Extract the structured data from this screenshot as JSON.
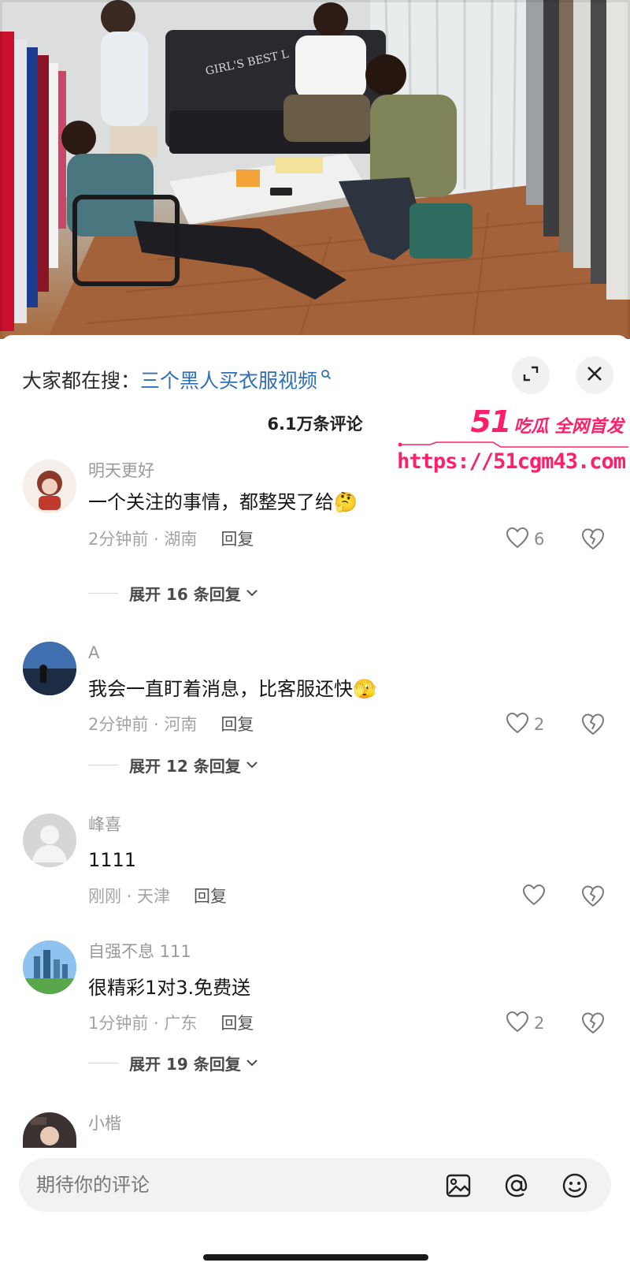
{
  "header": {
    "search_prefix": "大家都在搜：",
    "search_term": "三个黑人买衣服视频",
    "comment_count": "6.1万条评论"
  },
  "watermark": {
    "badge_number": "51",
    "badge_text": "吃瓜 全网首发",
    "url": "https://51cgm43.com"
  },
  "comments": [
    {
      "name": "明天更好",
      "text": "一个关注的事情，都整哭了给🤔",
      "time_location": "2分钟前 · 湖南",
      "reply_label": "回复",
      "likes": "6",
      "expand": "展开 16 条回复"
    },
    {
      "name": "A",
      "text": "我会一直盯着消息，比客服还快🫣",
      "time_location": "2分钟前 · 河南",
      "reply_label": "回复",
      "likes": "2",
      "expand": "展开 12 条回复"
    },
    {
      "name": "峰喜",
      "text": "1111",
      "time_location": "刚刚 · 天津",
      "reply_label": "回复",
      "likes": ""
    },
    {
      "name": "自强不息 111",
      "text": "很精彩1对3.免费送",
      "time_location": "1分钟前 · 广东",
      "reply_label": "回复",
      "likes": "2",
      "expand": "展开 19 条回复"
    },
    {
      "name": "小楷"
    }
  ],
  "video": {
    "sofa_text": "GIRL'S BEST L"
  },
  "input": {
    "placeholder": "期待你的评论"
  },
  "icons": [
    "expand-icon",
    "close-icon",
    "search-icon",
    "heart-icon",
    "dislike-heart-icon",
    "chevron-down-icon",
    "image-icon",
    "at-icon",
    "emoji-icon"
  ],
  "colors": {
    "link": "#2f6fb5",
    "watermark": "#ff1e68",
    "muted_text": "#9a9a9a"
  }
}
